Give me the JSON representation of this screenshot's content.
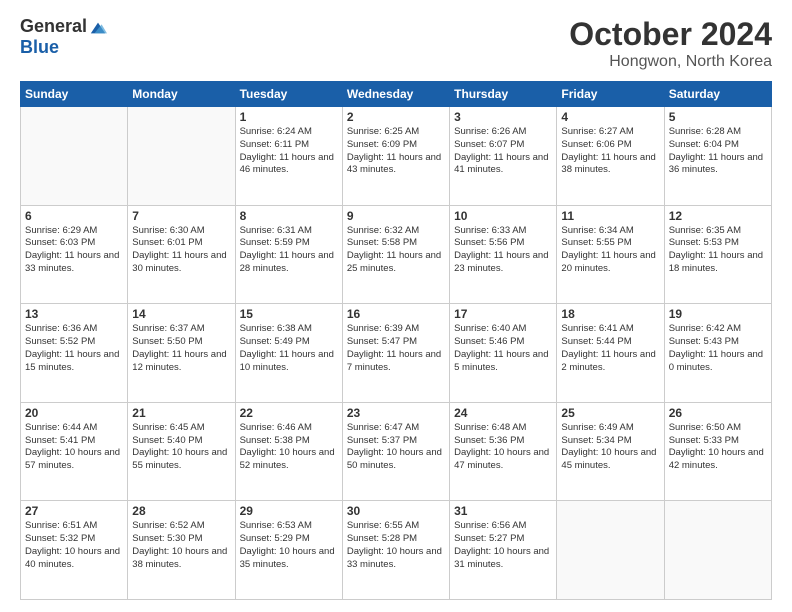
{
  "logo": {
    "general": "General",
    "blue": "Blue"
  },
  "header": {
    "month": "October 2024",
    "location": "Hongwon, North Korea"
  },
  "weekdays": [
    "Sunday",
    "Monday",
    "Tuesday",
    "Wednesday",
    "Thursday",
    "Friday",
    "Saturday"
  ],
  "weeks": [
    [
      {
        "day": "",
        "info": ""
      },
      {
        "day": "",
        "info": ""
      },
      {
        "day": "1",
        "info": "Sunrise: 6:24 AM\nSunset: 6:11 PM\nDaylight: 11 hours and 46 minutes."
      },
      {
        "day": "2",
        "info": "Sunrise: 6:25 AM\nSunset: 6:09 PM\nDaylight: 11 hours and 43 minutes."
      },
      {
        "day": "3",
        "info": "Sunrise: 6:26 AM\nSunset: 6:07 PM\nDaylight: 11 hours and 41 minutes."
      },
      {
        "day": "4",
        "info": "Sunrise: 6:27 AM\nSunset: 6:06 PM\nDaylight: 11 hours and 38 minutes."
      },
      {
        "day": "5",
        "info": "Sunrise: 6:28 AM\nSunset: 6:04 PM\nDaylight: 11 hours and 36 minutes."
      }
    ],
    [
      {
        "day": "6",
        "info": "Sunrise: 6:29 AM\nSunset: 6:03 PM\nDaylight: 11 hours and 33 minutes."
      },
      {
        "day": "7",
        "info": "Sunrise: 6:30 AM\nSunset: 6:01 PM\nDaylight: 11 hours and 30 minutes."
      },
      {
        "day": "8",
        "info": "Sunrise: 6:31 AM\nSunset: 5:59 PM\nDaylight: 11 hours and 28 minutes."
      },
      {
        "day": "9",
        "info": "Sunrise: 6:32 AM\nSunset: 5:58 PM\nDaylight: 11 hours and 25 minutes."
      },
      {
        "day": "10",
        "info": "Sunrise: 6:33 AM\nSunset: 5:56 PM\nDaylight: 11 hours and 23 minutes."
      },
      {
        "day": "11",
        "info": "Sunrise: 6:34 AM\nSunset: 5:55 PM\nDaylight: 11 hours and 20 minutes."
      },
      {
        "day": "12",
        "info": "Sunrise: 6:35 AM\nSunset: 5:53 PM\nDaylight: 11 hours and 18 minutes."
      }
    ],
    [
      {
        "day": "13",
        "info": "Sunrise: 6:36 AM\nSunset: 5:52 PM\nDaylight: 11 hours and 15 minutes."
      },
      {
        "day": "14",
        "info": "Sunrise: 6:37 AM\nSunset: 5:50 PM\nDaylight: 11 hours and 12 minutes."
      },
      {
        "day": "15",
        "info": "Sunrise: 6:38 AM\nSunset: 5:49 PM\nDaylight: 11 hours and 10 minutes."
      },
      {
        "day": "16",
        "info": "Sunrise: 6:39 AM\nSunset: 5:47 PM\nDaylight: 11 hours and 7 minutes."
      },
      {
        "day": "17",
        "info": "Sunrise: 6:40 AM\nSunset: 5:46 PM\nDaylight: 11 hours and 5 minutes."
      },
      {
        "day": "18",
        "info": "Sunrise: 6:41 AM\nSunset: 5:44 PM\nDaylight: 11 hours and 2 minutes."
      },
      {
        "day": "19",
        "info": "Sunrise: 6:42 AM\nSunset: 5:43 PM\nDaylight: 11 hours and 0 minutes."
      }
    ],
    [
      {
        "day": "20",
        "info": "Sunrise: 6:44 AM\nSunset: 5:41 PM\nDaylight: 10 hours and 57 minutes."
      },
      {
        "day": "21",
        "info": "Sunrise: 6:45 AM\nSunset: 5:40 PM\nDaylight: 10 hours and 55 minutes."
      },
      {
        "day": "22",
        "info": "Sunrise: 6:46 AM\nSunset: 5:38 PM\nDaylight: 10 hours and 52 minutes."
      },
      {
        "day": "23",
        "info": "Sunrise: 6:47 AM\nSunset: 5:37 PM\nDaylight: 10 hours and 50 minutes."
      },
      {
        "day": "24",
        "info": "Sunrise: 6:48 AM\nSunset: 5:36 PM\nDaylight: 10 hours and 47 minutes."
      },
      {
        "day": "25",
        "info": "Sunrise: 6:49 AM\nSunset: 5:34 PM\nDaylight: 10 hours and 45 minutes."
      },
      {
        "day": "26",
        "info": "Sunrise: 6:50 AM\nSunset: 5:33 PM\nDaylight: 10 hours and 42 minutes."
      }
    ],
    [
      {
        "day": "27",
        "info": "Sunrise: 6:51 AM\nSunset: 5:32 PM\nDaylight: 10 hours and 40 minutes."
      },
      {
        "day": "28",
        "info": "Sunrise: 6:52 AM\nSunset: 5:30 PM\nDaylight: 10 hours and 38 minutes."
      },
      {
        "day": "29",
        "info": "Sunrise: 6:53 AM\nSunset: 5:29 PM\nDaylight: 10 hours and 35 minutes."
      },
      {
        "day": "30",
        "info": "Sunrise: 6:55 AM\nSunset: 5:28 PM\nDaylight: 10 hours and 33 minutes."
      },
      {
        "day": "31",
        "info": "Sunrise: 6:56 AM\nSunset: 5:27 PM\nDaylight: 10 hours and 31 minutes."
      },
      {
        "day": "",
        "info": ""
      },
      {
        "day": "",
        "info": ""
      }
    ]
  ]
}
